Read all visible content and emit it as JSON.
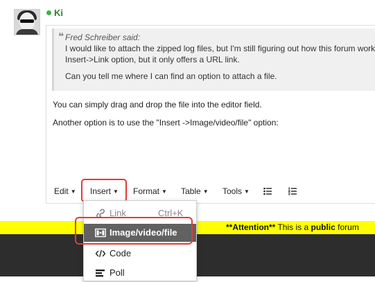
{
  "post": {
    "username": "Ki"
  },
  "quote": {
    "author": "Fred Schreiber said:",
    "line1": "I would like to attach the zipped log files, but I'm still figuring out how this forum works. I",
    "line2": "Insert->Link option, but it only offers a URL link.",
    "line3": "Can you tell me where I can find an option to attach a file."
  },
  "body": {
    "para1": "You can simply drag and drop the file into the editor field.",
    "para2": "Another option is to use the \"Insert ->Image/video/file\" option:"
  },
  "toolbar": {
    "edit": "Edit",
    "insert": "Insert",
    "format": "Format",
    "table": "Table",
    "tools": "Tools"
  },
  "dropdown": {
    "link": "Link",
    "link_shortcut": "Ctrl+K",
    "image": "Image/video/file",
    "code": "Code",
    "poll": "Poll"
  },
  "banner": {
    "bold1": "**Attention**",
    "text1": " This is a ",
    "bold2": "public",
    "text2": " forum"
  },
  "colors": {
    "highlight": "#e53935",
    "banner_bg": "#ffff00",
    "online": "#3cb043",
    "dropdown_active": "#616161"
  },
  "icons": [
    "online-status-icon",
    "caret-down-icon",
    "bullet-list-icon",
    "numbered-list-icon",
    "link-icon",
    "image-icon",
    "code-icon",
    "poll-icon"
  ]
}
